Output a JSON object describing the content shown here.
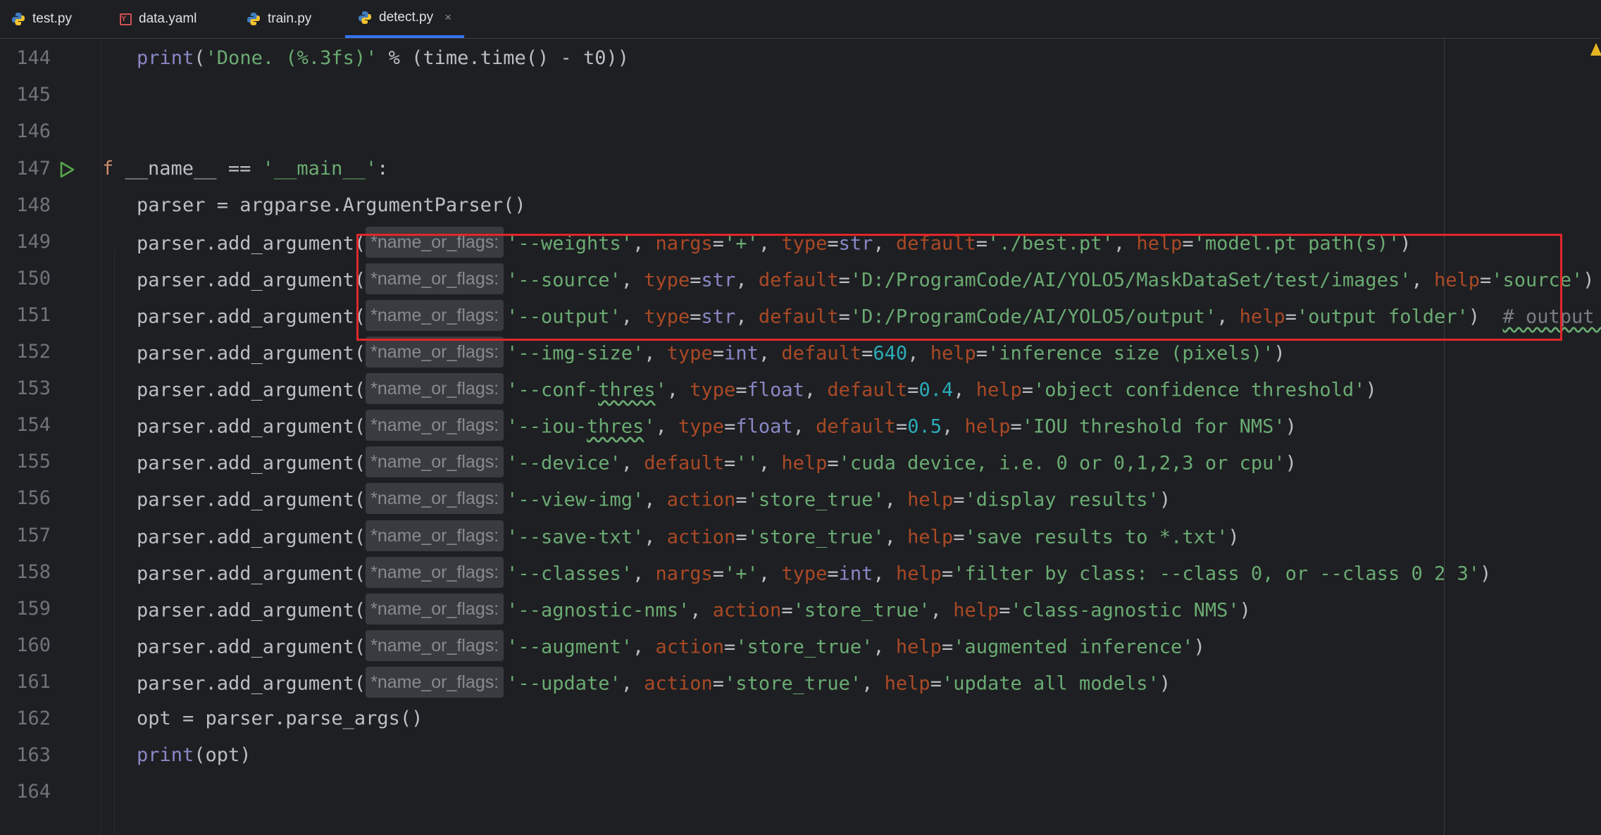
{
  "tabs": [
    {
      "label": "test.py",
      "icon": "python-file-icon"
    },
    {
      "label": "data.yaml",
      "icon": "yaml-file-icon"
    },
    {
      "label": "train.py",
      "icon": "python-file-icon"
    },
    {
      "label": "detect.py",
      "icon": "python-file-icon",
      "active": true
    }
  ],
  "tab_close_glyph": "×",
  "hint_label": "*name_or_flags:",
  "lines": [
    {
      "num": "144"
    },
    {
      "num": "145"
    },
    {
      "num": "146"
    },
    {
      "num": "147"
    },
    {
      "num": "148"
    },
    {
      "num": "149"
    },
    {
      "num": "150"
    },
    {
      "num": "151"
    },
    {
      "num": "152"
    },
    {
      "num": "153"
    },
    {
      "num": "154"
    },
    {
      "num": "155"
    },
    {
      "num": "156"
    },
    {
      "num": "157"
    },
    {
      "num": "158"
    },
    {
      "num": "159"
    },
    {
      "num": "160"
    },
    {
      "num": "161"
    },
    {
      "num": "162"
    },
    {
      "num": "163"
    },
    {
      "num": "164"
    }
  ],
  "code": {
    "l144": {
      "print": "print",
      "a": "(",
      "s1": "'Done. (%.3fs)'",
      "b": " % (time.time() - t0))"
    },
    "l147": {
      "kw": "f",
      "a": " __name__ == ",
      "s": "'__main__'",
      "b": ":"
    },
    "l148": {
      "t": "parser = argparse.ArgumentParser()"
    },
    "call": "parser.add_argument(",
    "l149": {
      "opt": "'--weights'",
      "p1": "nargs",
      "v1": "'+'",
      "p2": "type",
      "v2": "str",
      "p3": "default",
      "v3": "'./best.pt'",
      "p4": "help",
      "v4": "'model.pt path(s)'"
    },
    "l150": {
      "opt": "'--source'",
      "p1": "type",
      "v1": "str",
      "p2": "default",
      "v2": "'D:/ProgramCode/AI/YOLO5/MaskDataSet/test/images'",
      "p3": "help",
      "v3": "'source'"
    },
    "l151": {
      "opt": "'--output'",
      "p1": "type",
      "v1": "str",
      "p2": "default",
      "v2": "'D:/ProgramCode/AI/YOLO5/output'",
      "p3": "help",
      "v3": "'output folder'",
      "comment": "# output f"
    },
    "l152": {
      "opt": "'--img-size'",
      "p1": "type",
      "v1": "int",
      "p2": "default",
      "v2": "640",
      "p3": "help",
      "v3": "'inference size (pixels)'"
    },
    "l153": {
      "opt_a": "'--conf-",
      "opt_b": "thres",
      "opt_c": "'",
      "p1": "type",
      "v1": "float",
      "p2": "default",
      "v2": "0.4",
      "p3": "help",
      "v3": "'object confidence threshold'"
    },
    "l154": {
      "opt_a": "'--iou-",
      "opt_b": "thres",
      "opt_c": "'",
      "p1": "type",
      "v1": "float",
      "p2": "default",
      "v2": "0.5",
      "p3": "help",
      "v3": "'IOU threshold for NMS'"
    },
    "l155": {
      "opt": "'--device'",
      "p1": "default",
      "v1": "''",
      "p2": "help",
      "v2": "'cuda device, i.e. 0 or 0,1,2,3 or cpu'"
    },
    "l156": {
      "opt": "'--view-img'",
      "p1": "action",
      "v1": "'store_true'",
      "p2": "help",
      "v2": "'display results'"
    },
    "l157": {
      "opt": "'--save-txt'",
      "p1": "action",
      "v1": "'store_true'",
      "p2": "help",
      "v2": "'save results to *.txt'"
    },
    "l158": {
      "opt": "'--classes'",
      "p1": "nargs",
      "v1": "'+'",
      "p2": "type",
      "v2": "int",
      "p3": "help",
      "v3": "'filter by class: --class 0, or --class 0 2 3'"
    },
    "l159": {
      "opt": "'--agnostic-nms'",
      "p1": "action",
      "v1": "'store_true'",
      "p2": "help",
      "v2": "'class-agnostic NMS'"
    },
    "l160": {
      "opt": "'--augment'",
      "p1": "action",
      "v1": "'store_true'",
      "p2": "help",
      "v2": "'augmented inference'"
    },
    "l161": {
      "opt": "'--update'",
      "p1": "action",
      "v1": "'store_true'",
      "p2": "help",
      "v2": "'update all models'"
    },
    "l162": {
      "t": "opt = parser.parse_args()"
    },
    "l163": {
      "print": "print",
      "b": "(opt)"
    }
  },
  "colors": {
    "background": "#1e1f22",
    "keyword": "#cf8e6d",
    "string": "#6aab73",
    "param": "#aa4926",
    "number": "#2aacb8",
    "builtin": "#8888c6",
    "highlight_box": "#e0272a",
    "active_tab_underline": "#3574f0"
  }
}
